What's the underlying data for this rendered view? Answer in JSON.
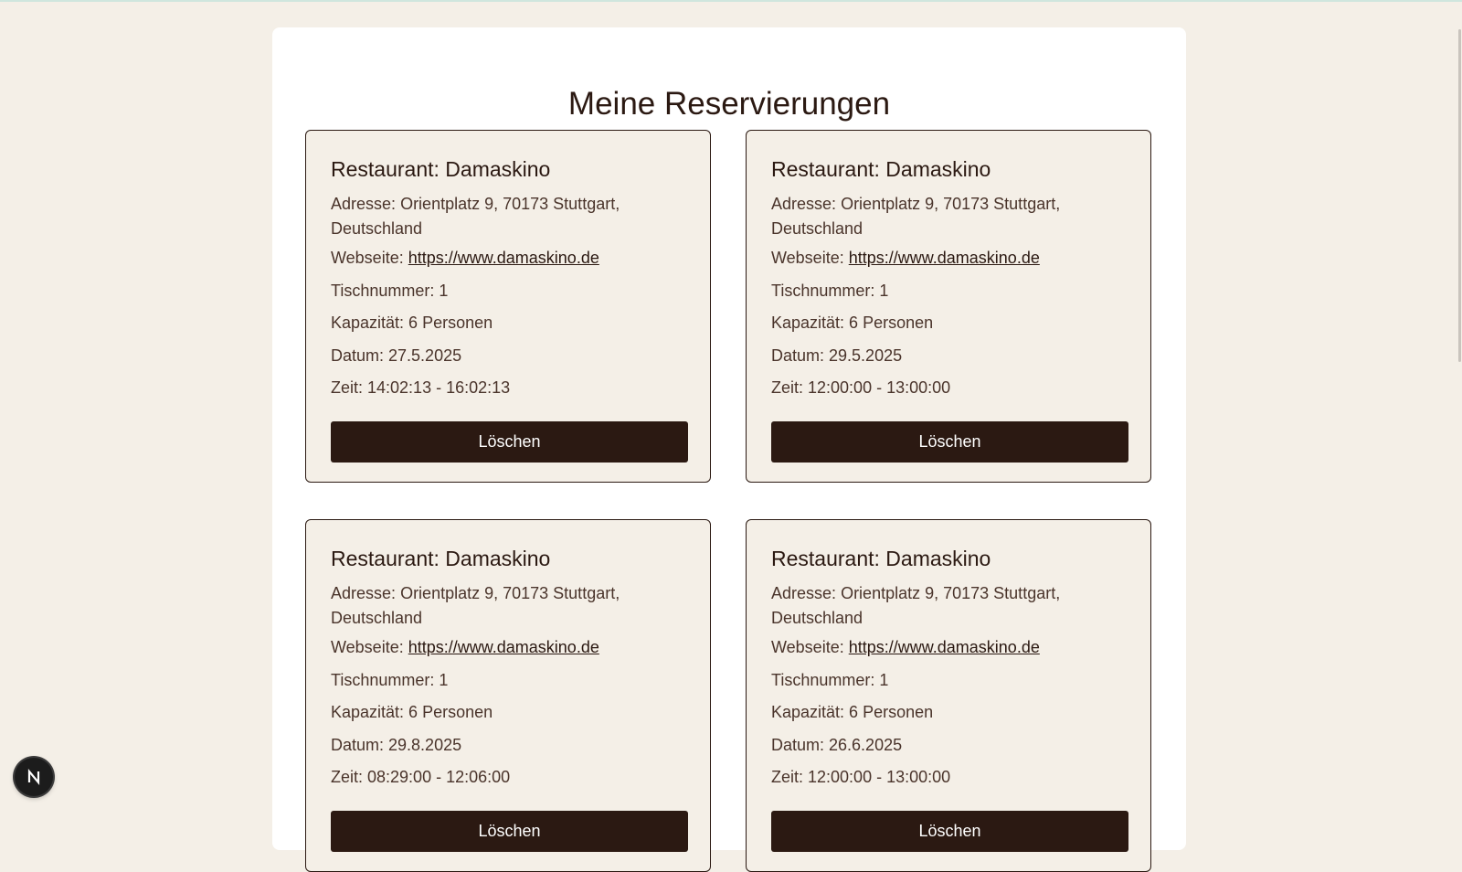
{
  "page": {
    "title": "Meine Reservierungen"
  },
  "colors": {
    "background": "#f4efe7",
    "panel": "#ffffff",
    "accent": "#2b1912",
    "button_text": "#ffffff"
  },
  "reservations": [
    {
      "restaurant": "Restaurant: Damaskino",
      "address_label": "Adresse:",
      "address": "Orientplatz 9, 70173 Stuttgart, Deutschland",
      "website_label": "Webseite:",
      "website": "https://www.damaskino.de",
      "table": "Tischnummer: 1",
      "capacity": "Kapazität: 6 Personen",
      "date": "Datum: 27.5.2025",
      "time": "Zeit: 14:02:13 - 16:02:13",
      "delete_label": "Löschen"
    },
    {
      "restaurant": "Restaurant: Damaskino",
      "address_label": "Adresse:",
      "address": "Orientplatz 9, 70173 Stuttgart, Deutschland",
      "website_label": "Webseite:",
      "website": "https://www.damaskino.de",
      "table": "Tischnummer: 1",
      "capacity": "Kapazität: 6 Personen",
      "date": "Datum: 29.5.2025",
      "time": "Zeit: 12:00:00 - 13:00:00",
      "delete_label": "Löschen"
    },
    {
      "restaurant": "Restaurant: Damaskino",
      "address_label": "Adresse:",
      "address": "Orientplatz 9, 70173 Stuttgart, Deutschland",
      "website_label": "Webseite:",
      "website": "https://www.damaskino.de",
      "table": "Tischnummer: 1",
      "capacity": "Kapazität: 6 Personen",
      "date": "Datum: 29.8.2025",
      "time": "Zeit: 08:29:00 - 12:06:00",
      "delete_label": "Löschen"
    },
    {
      "restaurant": "Restaurant: Damaskino",
      "address_label": "Adresse:",
      "address": "Orientplatz 9, 70173 Stuttgart, Deutschland",
      "website_label": "Webseite:",
      "website": "https://www.damaskino.de",
      "table": "Tischnummer: 1",
      "capacity": "Kapazität: 6 Personen",
      "date": "Datum: 26.6.2025",
      "time": "Zeit: 12:00:00 - 13:00:00",
      "delete_label": "Löschen"
    }
  ],
  "dev_badge": {
    "letter": "N",
    "icon": "nextjs-icon"
  }
}
